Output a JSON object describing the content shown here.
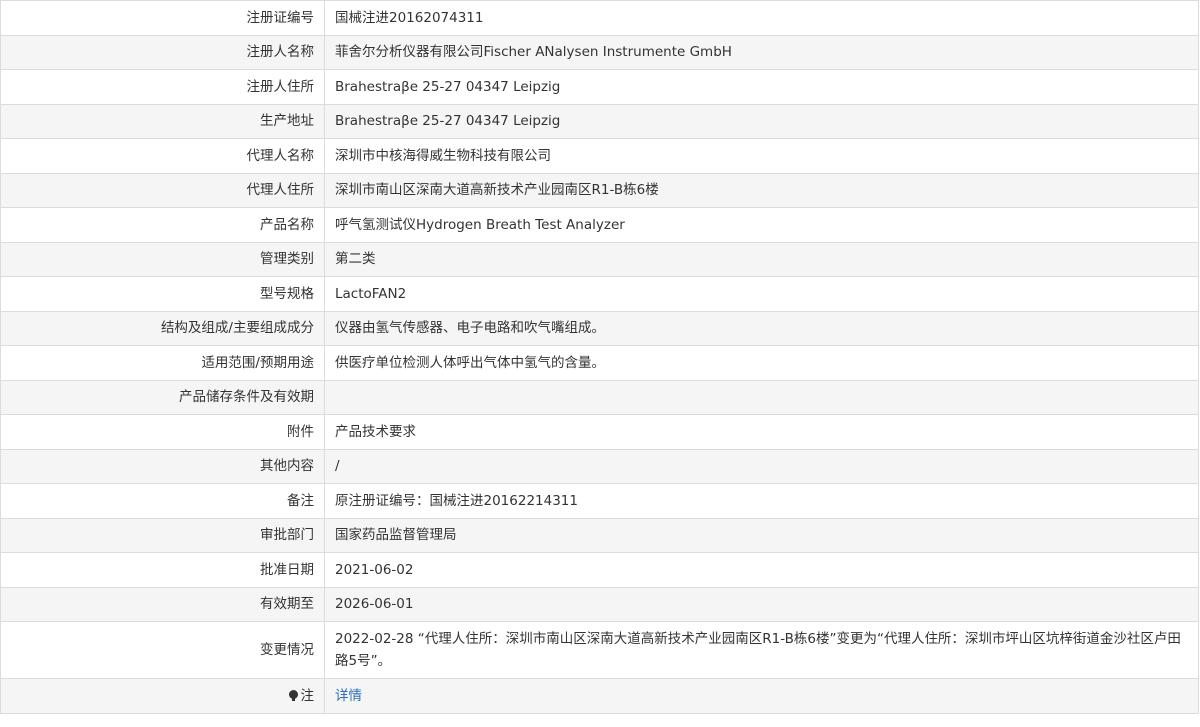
{
  "rows": [
    {
      "label": "注册证编号",
      "value": "国械注进20162074311"
    },
    {
      "label": "注册人名称",
      "value": "菲舍尔分析仪器有限公司Fischer ANalysen Instrumente GmbH"
    },
    {
      "label": "注册人住所",
      "value": "Brahestraβe 25-27 04347 Leipzig"
    },
    {
      "label": "生产地址",
      "value": "Brahestraβe 25-27 04347 Leipzig"
    },
    {
      "label": "代理人名称",
      "value": "深圳市中核海得威生物科技有限公司"
    },
    {
      "label": "代理人住所",
      "value": "深圳市南山区深南大道高新技术产业园南区R1-B栋6楼"
    },
    {
      "label": "产品名称",
      "value": "呼气氢测试仪Hydrogen Breath Test Analyzer"
    },
    {
      "label": "管理类别",
      "value": "第二类"
    },
    {
      "label": "型号规格",
      "value": "LactoFAN2"
    },
    {
      "label": "结构及组成/主要组成成分",
      "value": "仪器由氢气传感器、电子电路和吹气嘴组成。"
    },
    {
      "label": "适用范围/预期用途",
      "value": "供医疗单位检测人体呼出气体中氢气的含量。"
    },
    {
      "label": "产品储存条件及有效期",
      "value": ""
    },
    {
      "label": "附件",
      "value": "产品技术要求"
    },
    {
      "label": "其他内容",
      "value": "/"
    },
    {
      "label": "备注",
      "value": "原注册证编号：国械注进20162214311"
    },
    {
      "label": "审批部门",
      "value": "国家药品监督管理局"
    },
    {
      "label": "批准日期",
      "value": "2021-06-02"
    },
    {
      "label": "有效期至",
      "value": "2026-06-01"
    },
    {
      "label": "变更情况",
      "value": "2022-02-28 “代理人住所：深圳市南山区深南大道高新技术产业园南区R1-B栋6楼”变更为“代理人住所：深圳市坪山区坑梓街道金沙社区卢田路5号”。"
    }
  ],
  "note": {
    "icon": "bulb-icon",
    "label": "注",
    "link_text": "详情"
  }
}
